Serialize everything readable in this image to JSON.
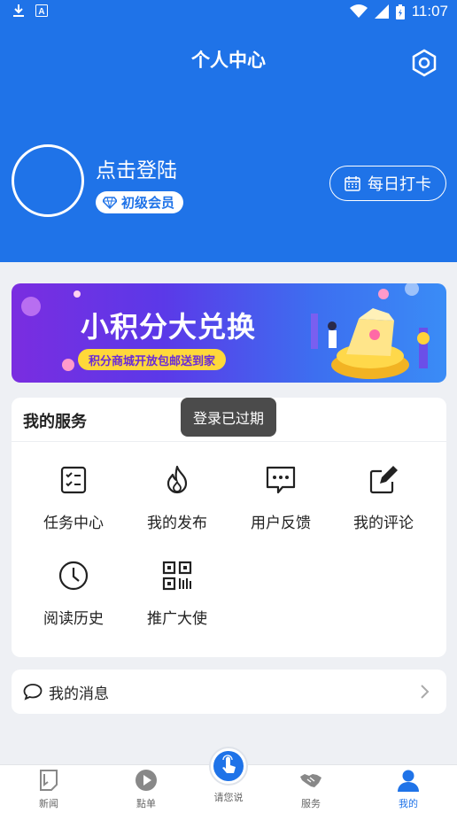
{
  "status_bar": {
    "time": "11:07"
  },
  "header": {
    "title": "个人中心",
    "login_text": "点击登陆",
    "member_badge": "初级会员",
    "checkin_label": "每日打卡"
  },
  "banner": {
    "title": "小积分大兑换",
    "subtitle": "积分商城开放包邮送到家"
  },
  "services": {
    "title": "我的服务",
    "items": [
      {
        "label": "任务中心",
        "icon": "task-icon"
      },
      {
        "label": "我的发布",
        "icon": "fire-icon"
      },
      {
        "label": "用户反馈",
        "icon": "feedback-icon"
      },
      {
        "label": "我的评论",
        "icon": "edit-icon"
      },
      {
        "label": "阅读历史",
        "icon": "clock-icon"
      },
      {
        "label": "推广大使",
        "icon": "qrcode-icon"
      }
    ]
  },
  "toast": {
    "text": "登录已过期"
  },
  "messages": {
    "label": "我的消息"
  },
  "nav": {
    "items": [
      {
        "label": "新闻",
        "icon": "news-icon"
      },
      {
        "label": "點单",
        "icon": "play-icon"
      },
      {
        "label": "请您说",
        "icon": "touch-icon"
      },
      {
        "label": "服务",
        "icon": "handshake-icon"
      },
      {
        "label": "我的",
        "icon": "user-icon",
        "active": true
      }
    ]
  },
  "colors": {
    "primary": "#1f73e8",
    "banner_pill": "#ffd83a"
  }
}
